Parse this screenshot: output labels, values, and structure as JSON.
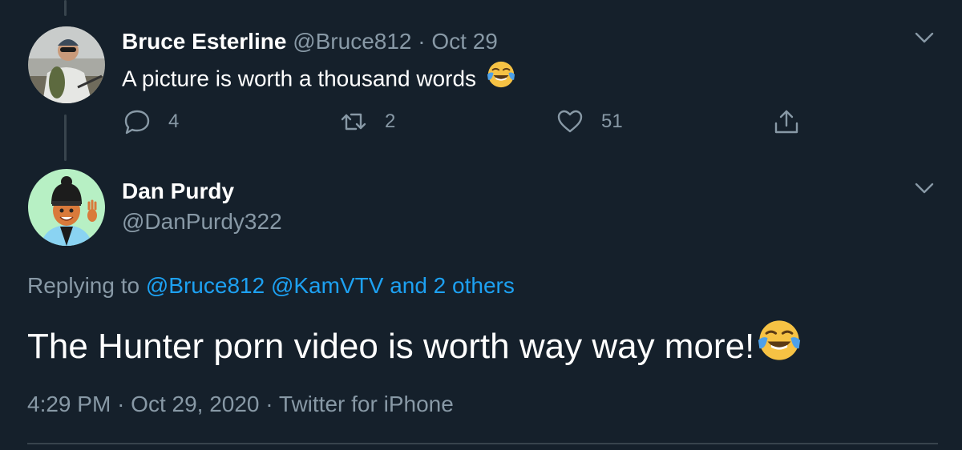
{
  "colors": {
    "background": "#15202b",
    "text_primary": "#ffffff",
    "text_muted": "#8899a6",
    "link": "#1da1f2",
    "border": "#38444d"
  },
  "parent_tweet": {
    "name": "Bruce Esterline",
    "handle": "@Bruce812",
    "separator": "·",
    "date": "Oct 29",
    "text": "A picture is worth a thousand words",
    "text_emoji": "face-with-tears-of-joy",
    "actions": {
      "reply": {
        "icon": "reply-icon",
        "count": "4"
      },
      "retweet": {
        "icon": "retweet-icon",
        "count": "2"
      },
      "like": {
        "icon": "heart-icon",
        "count": "51"
      },
      "share": {
        "icon": "share-icon"
      }
    },
    "menu_icon": "chevron-down-icon"
  },
  "main_tweet": {
    "name": "Dan Purdy",
    "handle": "@DanPurdy322",
    "replying_prefix": "Replying to",
    "replying_to": [
      "@Bruce812",
      "@KamVTV"
    ],
    "replying_others": "and 2 others",
    "text": "The Hunter porn video is worth way way more!",
    "text_emoji": "face-with-tears-of-joy",
    "time": "4:29 PM",
    "date": "Oct 29, 2020",
    "source": "Twitter for iPhone",
    "separator": "·",
    "menu_icon": "chevron-down-icon"
  }
}
